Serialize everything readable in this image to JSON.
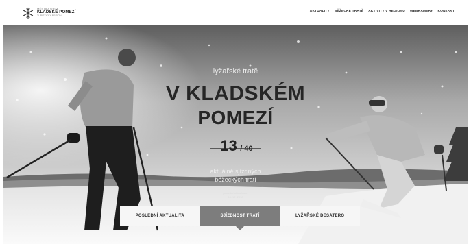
{
  "header": {
    "logo_prefix": "MĚSTA A OBCE",
    "logo_main": "KLADSKÉ POMEZÍ",
    "logo_sub": "TURISTICKÝ REGION",
    "nav": [
      {
        "label": "AKTUALITY"
      },
      {
        "label": "BĚŽECKÉ TRATĚ"
      },
      {
        "label": "AKTIVITY V REGIONU"
      },
      {
        "label": "WEBKAMERY"
      },
      {
        "label": "KONTAKT"
      }
    ]
  },
  "hero": {
    "subtitle": "lyžařské tratě",
    "title_line1": "V KLADSKÉM",
    "title_line2": "POMEZÍ",
    "count_open": "13",
    "count_total": "/ 40",
    "desc_line1": "aktuálně sjízdných",
    "desc_line2": "běžeckých tratí",
    "update_label": "poslední aktualizace",
    "update_date": "18. 12. 2018"
  },
  "tabs": [
    {
      "label": "POSLEDNÍ AKTUALITA",
      "active": false
    },
    {
      "label": "SJÍZDNOST TRATÍ",
      "active": true
    },
    {
      "label": "LYŽAŘSKÉ DESATERO",
      "active": false
    }
  ],
  "colors": {
    "header_bg": "#ffffff",
    "active_tab": "#7d7d7d",
    "inactive_tab": "#f6f6f6",
    "title_text": "#262626"
  },
  "icons": [
    "snowflake-logo-icon",
    "chevron-down-icon"
  ]
}
